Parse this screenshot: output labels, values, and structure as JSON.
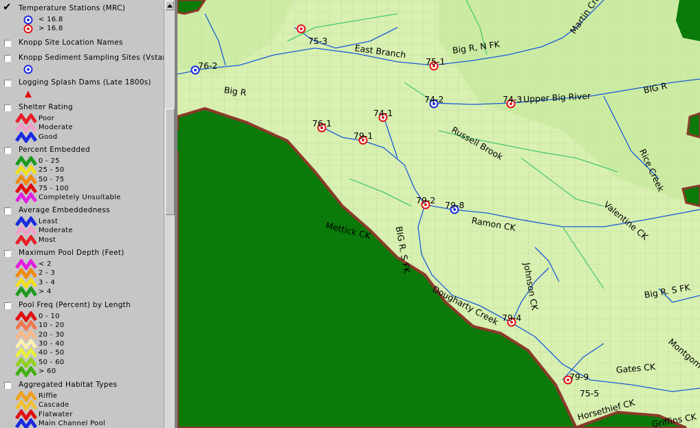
{
  "legend": {
    "layers": [
      {
        "name": "Temperature Stations (MRC)",
        "checked": true,
        "entries": [
          {
            "label": "< 16.8",
            "symbol": "blue-station-icon"
          },
          {
            "label": "> 16.8",
            "symbol": "red-station-icon"
          }
        ]
      },
      {
        "name": "Knopp Site Location Names",
        "checked": false,
        "entries": []
      },
      {
        "name": "Knopp Sediment Sampling Sites (Vstar)",
        "checked": false,
        "entries": [
          {
            "label": "",
            "symbol": "blue-station-icon"
          }
        ]
      },
      {
        "name": "Logging Splash Dams (Late 1800s)",
        "checked": false,
        "entries": [
          {
            "label": "",
            "symbol": "red-triangle-icon"
          }
        ]
      },
      {
        "name": "Shelter Rating",
        "checked": false,
        "entries": [
          {
            "label": "Poor",
            "color": "#e8202a"
          },
          {
            "label": "Moderate",
            "color": "#f0a0c8"
          },
          {
            "label": "Good",
            "color": "#1a2ae0"
          }
        ]
      },
      {
        "name": "Percent Embedded",
        "checked": false,
        "entries": [
          {
            "label": "0 - 25",
            "color": "#1c9a1c"
          },
          {
            "label": "25 - 50",
            "color": "#f0e020"
          },
          {
            "label": "50 - 75",
            "color": "#f08a10"
          },
          {
            "label": "75 - 100",
            "color": "#e01010"
          },
          {
            "label": "Completely Unsuitable",
            "color": "#e020e0"
          }
        ]
      },
      {
        "name": "Average Embeddedness",
        "checked": false,
        "entries": [
          {
            "label": "Least",
            "color": "#1a2ae0"
          },
          {
            "label": "Moderate",
            "color": "#f0a0c8"
          },
          {
            "label": "Most",
            "color": "#e8202a"
          }
        ]
      },
      {
        "name": "Maximum Pool Depth (Feet)",
        "checked": false,
        "entries": [
          {
            "label": "< 2",
            "color": "#e020e0"
          },
          {
            "label": "2 - 3",
            "color": "#f08a10"
          },
          {
            "label": "3 - 4",
            "color": "#f0e020"
          },
          {
            "label": "> 4",
            "color": "#1c9a1c"
          }
        ]
      },
      {
        "name": "Pool Freq (Percent) by Length",
        "checked": false,
        "entries": [
          {
            "label": "0 - 10",
            "color": "#e01010"
          },
          {
            "label": "10 - 20",
            "color": "#f07850"
          },
          {
            "label": "20 - 30",
            "color": "#f8b888"
          },
          {
            "label": "30 - 40",
            "color": "#fff0b0"
          },
          {
            "label": "40 - 50",
            "color": "#e8f040"
          },
          {
            "label": "50 - 60",
            "color": "#90d020"
          },
          {
            "label": "> 60",
            "color": "#40b010"
          }
        ]
      },
      {
        "name": "Aggregated Habitat Types",
        "checked": false,
        "entries": [
          {
            "label": "Riffle",
            "color": "#f0a020"
          },
          {
            "label": "Cascade",
            "color": "#f0c030"
          },
          {
            "label": "Flatwater",
            "color": "#e01010"
          },
          {
            "label": "Main Channel Pool",
            "color": "#1a2ae0"
          }
        ]
      }
    ]
  },
  "map": {
    "colors": {
      "land": "#d8f0b0",
      "forest": "#0a7a0a",
      "boundary": "#8b3a2a",
      "river": "#1a5ad8",
      "creek": "#22c060",
      "grid": "#9aa890"
    },
    "stations": [
      {
        "id": "75-3",
        "type": "red"
      },
      {
        "id": "76-2",
        "type": "blue"
      },
      {
        "id": "75-1",
        "type": "red"
      },
      {
        "id": "74-2",
        "type": "blue"
      },
      {
        "id": "74-3",
        "type": "red"
      },
      {
        "id": "74-1",
        "type": "red"
      },
      {
        "id": "76-1",
        "type": "red"
      },
      {
        "id": "79-1",
        "type": "red"
      },
      {
        "id": "79-2",
        "type": "red"
      },
      {
        "id": "79-8",
        "type": "blue"
      },
      {
        "id": "79-4",
        "type": "red"
      },
      {
        "id": "79-9",
        "type": "red"
      },
      {
        "id": "75-5",
        "type": "none"
      }
    ],
    "labels": [
      "East Branch",
      "Big R, N FK",
      "Martin Creek",
      "Big R",
      "Upper Big River",
      "BIG R",
      "Russell Brook",
      "Rice Creek",
      "Valentine CK",
      "Ramon CK",
      "Mettick CK",
      "BIG R. S FK",
      "Johnson CK",
      "Dougharty Creek",
      "Big R. S FK",
      "Montgomery",
      "Gates CK",
      "Horsethief CK",
      "Griffins CK"
    ]
  }
}
